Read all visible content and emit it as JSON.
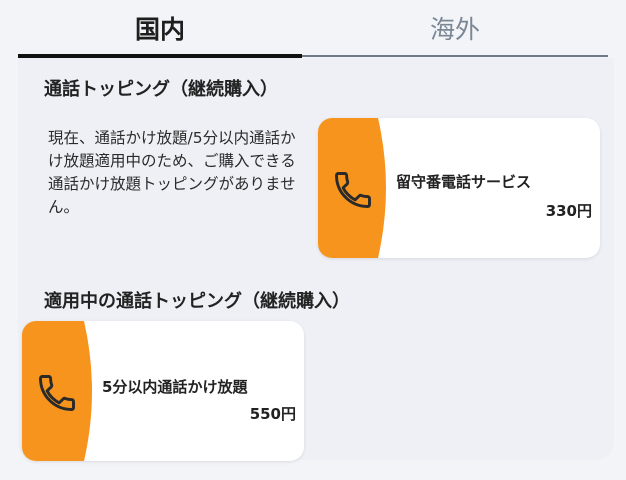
{
  "tabs": [
    {
      "label": "国内",
      "active": true
    },
    {
      "label": "海外",
      "active": false
    }
  ],
  "available_section": {
    "title": "通話トッピング（継続購入）",
    "notice": "現在、通話かけ放題/5分以内通話かけ放題適用中のため、ご購入できる通話かけ放題トッピングがありません。",
    "card": {
      "name": "留守番電話サービス",
      "price": "330円",
      "icon": "phone-icon"
    }
  },
  "applied_section": {
    "title": "適用中の通話トッピング（継続購入）",
    "card": {
      "name": "5分以内通話かけ放題",
      "price": "550円",
      "icon": "phone-icon"
    }
  },
  "colors": {
    "accent": "#f7941d",
    "tab_active": "#111111",
    "tab_inactive": "#7b8794",
    "panel": "#eef0f6"
  }
}
